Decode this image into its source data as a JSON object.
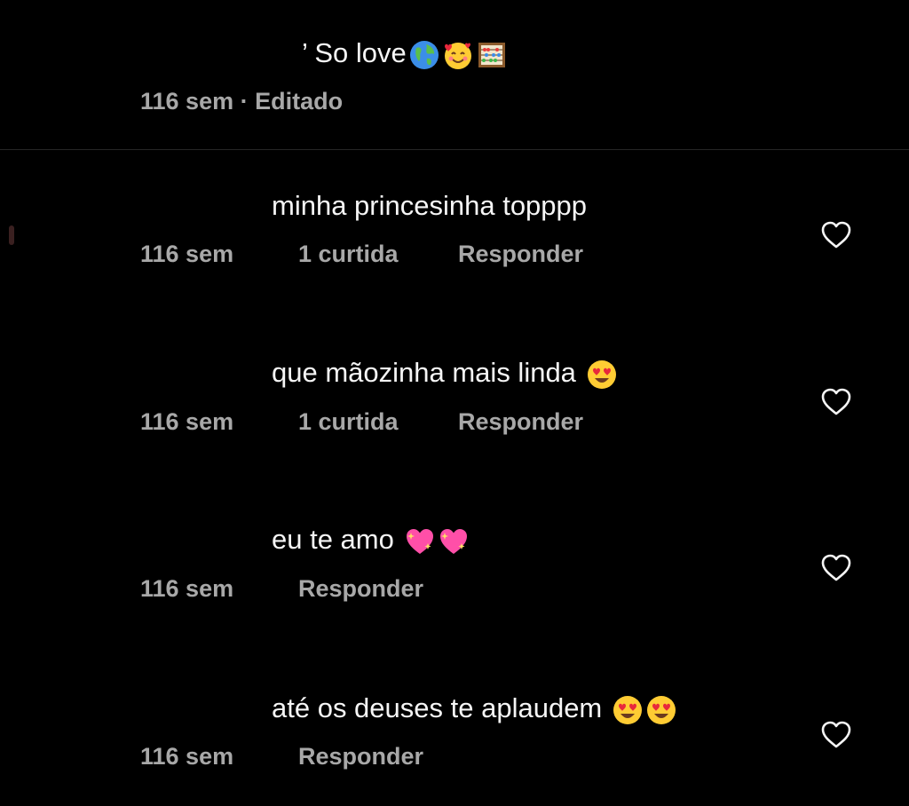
{
  "comments": [
    {
      "username": "",
      "text": "So love",
      "emojis": [
        "earth-globe-icon",
        "smiling-face-with-hearts-icon",
        "abacus-icon"
      ],
      "time": "116 sem",
      "separator": "·",
      "edited_label": "Editado",
      "likes_label": "",
      "reply_label": ""
    },
    {
      "username": "",
      "text": "minha princesinha topppp",
      "emojis": [],
      "time": "116 sem",
      "likes_label": "1 curtida",
      "reply_label": "Responder"
    },
    {
      "username": "",
      "text": "que mãozinha mais linda",
      "emojis": [
        "heart-eyes-icon"
      ],
      "time": "116 sem",
      "likes_label": "1 curtida",
      "reply_label": "Responder"
    },
    {
      "username": "",
      "text": "eu te amo",
      "emojis": [
        "sparkling-heart-icon",
        "sparkling-heart-icon"
      ],
      "time": "116 sem",
      "likes_label": "",
      "reply_label": "Responder"
    },
    {
      "username": "",
      "text": "até os deuses te aplaudem",
      "emojis": [
        "heart-eyes-icon",
        "heart-eyes-icon"
      ],
      "time": "116 sem",
      "likes_label": "",
      "reply_label": "Responder"
    }
  ],
  "colors": {
    "background": "#000000",
    "text": "#f5f5f5",
    "meta_text": "#a8a8a8",
    "divider": "#262626",
    "heart_outline": "#f5f5f5"
  }
}
